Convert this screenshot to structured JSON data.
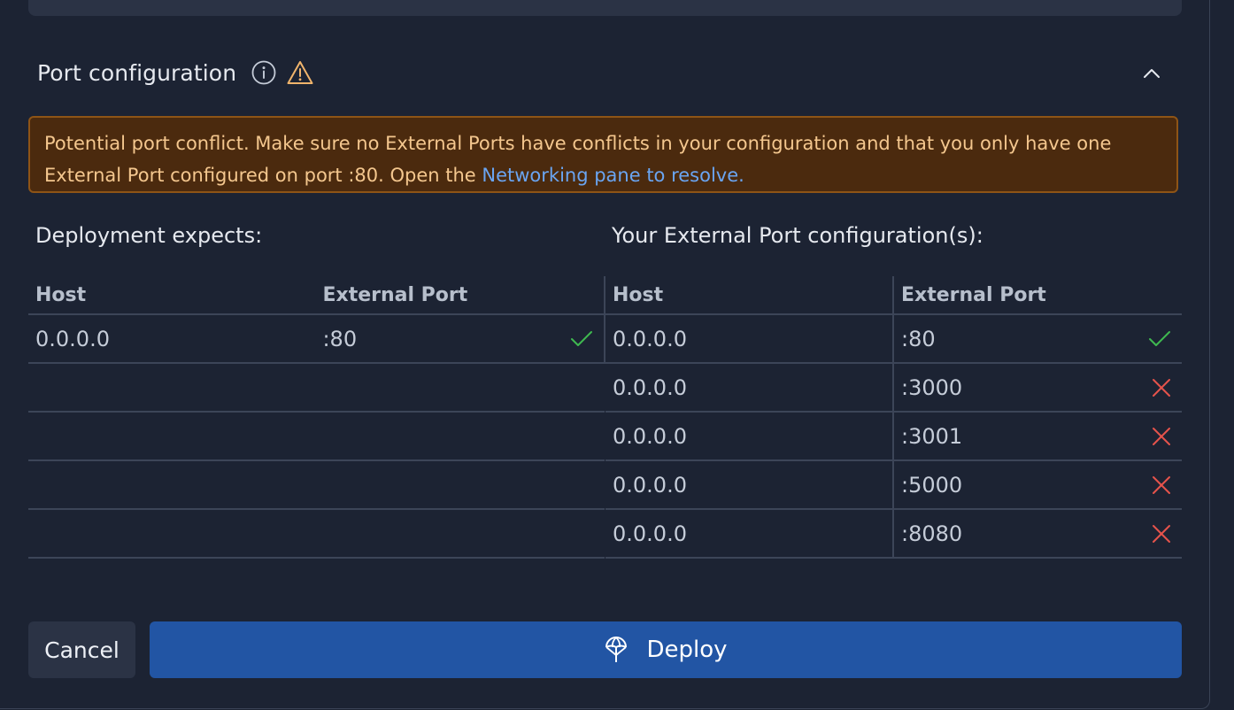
{
  "section": {
    "title": "Port configuration",
    "icons": [
      "info-icon",
      "warning-icon",
      "chevron-up-icon"
    ]
  },
  "warning": {
    "text": "Potential port conflict. Make sure no External Ports have conflicts in your configuration and that you only have one External Port configured on port :80. Open the ",
    "link": "Networking pane to resolve.",
    "colors": {
      "background": "#4b2a0e",
      "border": "#8e5416",
      "text": "#f4c78e",
      "link": "#6aa5f2"
    }
  },
  "expected": {
    "title": "Deployment expects:",
    "headers": {
      "host": "Host",
      "port": "External Port"
    },
    "rows": [
      {
        "host": "0.0.0.0",
        "port": ":80",
        "status": "ok"
      }
    ]
  },
  "configured": {
    "title": "Your External Port configuration(s):",
    "headers": {
      "host": "Host",
      "port": "External Port"
    },
    "rows": [
      {
        "host": "0.0.0.0",
        "port": ":80",
        "status": "ok"
      },
      {
        "host": "0.0.0.0",
        "port": ":3000",
        "status": "error"
      },
      {
        "host": "0.0.0.0",
        "port": ":3001",
        "status": "error"
      },
      {
        "host": "0.0.0.0",
        "port": ":5000",
        "status": "error"
      },
      {
        "host": "0.0.0.0",
        "port": ":8080",
        "status": "error"
      }
    ]
  },
  "actions": {
    "cancel": "Cancel",
    "deploy": "Deploy",
    "deploy_icon": "deploy-icon"
  },
  "colors": {
    "background": "#1c2333",
    "ok": "#3fb950",
    "error": "#e5534b",
    "primary": "#2255a4"
  }
}
